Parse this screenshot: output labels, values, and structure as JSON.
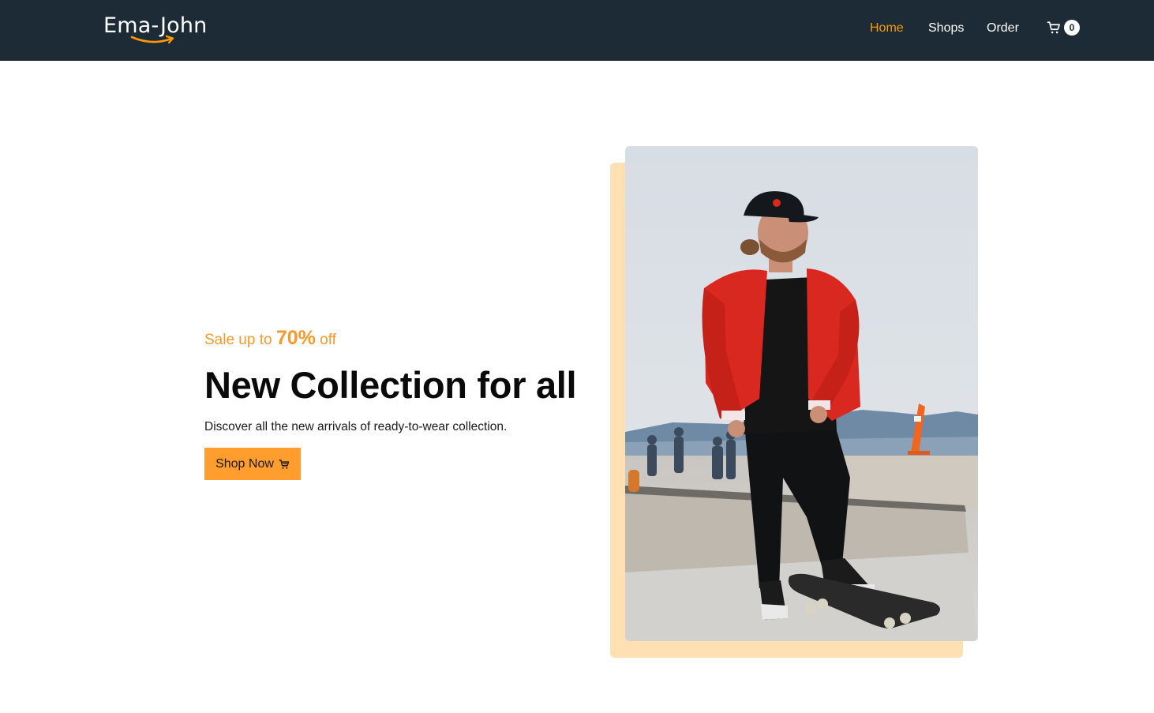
{
  "header": {
    "logo_text": "Ema-John",
    "nav": [
      {
        "label": "Home",
        "active": true
      },
      {
        "label": "Shops",
        "active": false
      },
      {
        "label": "Order",
        "active": false
      }
    ],
    "cart": {
      "icon": "shopping-cart-icon",
      "count": "0"
    }
  },
  "hero": {
    "sale_prefix": "Sale up to ",
    "sale_percent": "70%",
    "sale_suffix": " off",
    "headline": "New Collection for all",
    "subtext": "Discover all the new arrivals of ready-to-wear collection.",
    "button_label": "Shop Now",
    "button_icon": "cart-icon",
    "image_description_icon": "skateboarder-photo"
  },
  "colors": {
    "nav_bg": "#1c2b35",
    "accent": "#ff9900",
    "sale_text": "#f8992b",
    "button_bg": "#ff9d2f",
    "photo_backdrop": "#ffe0b2"
  }
}
